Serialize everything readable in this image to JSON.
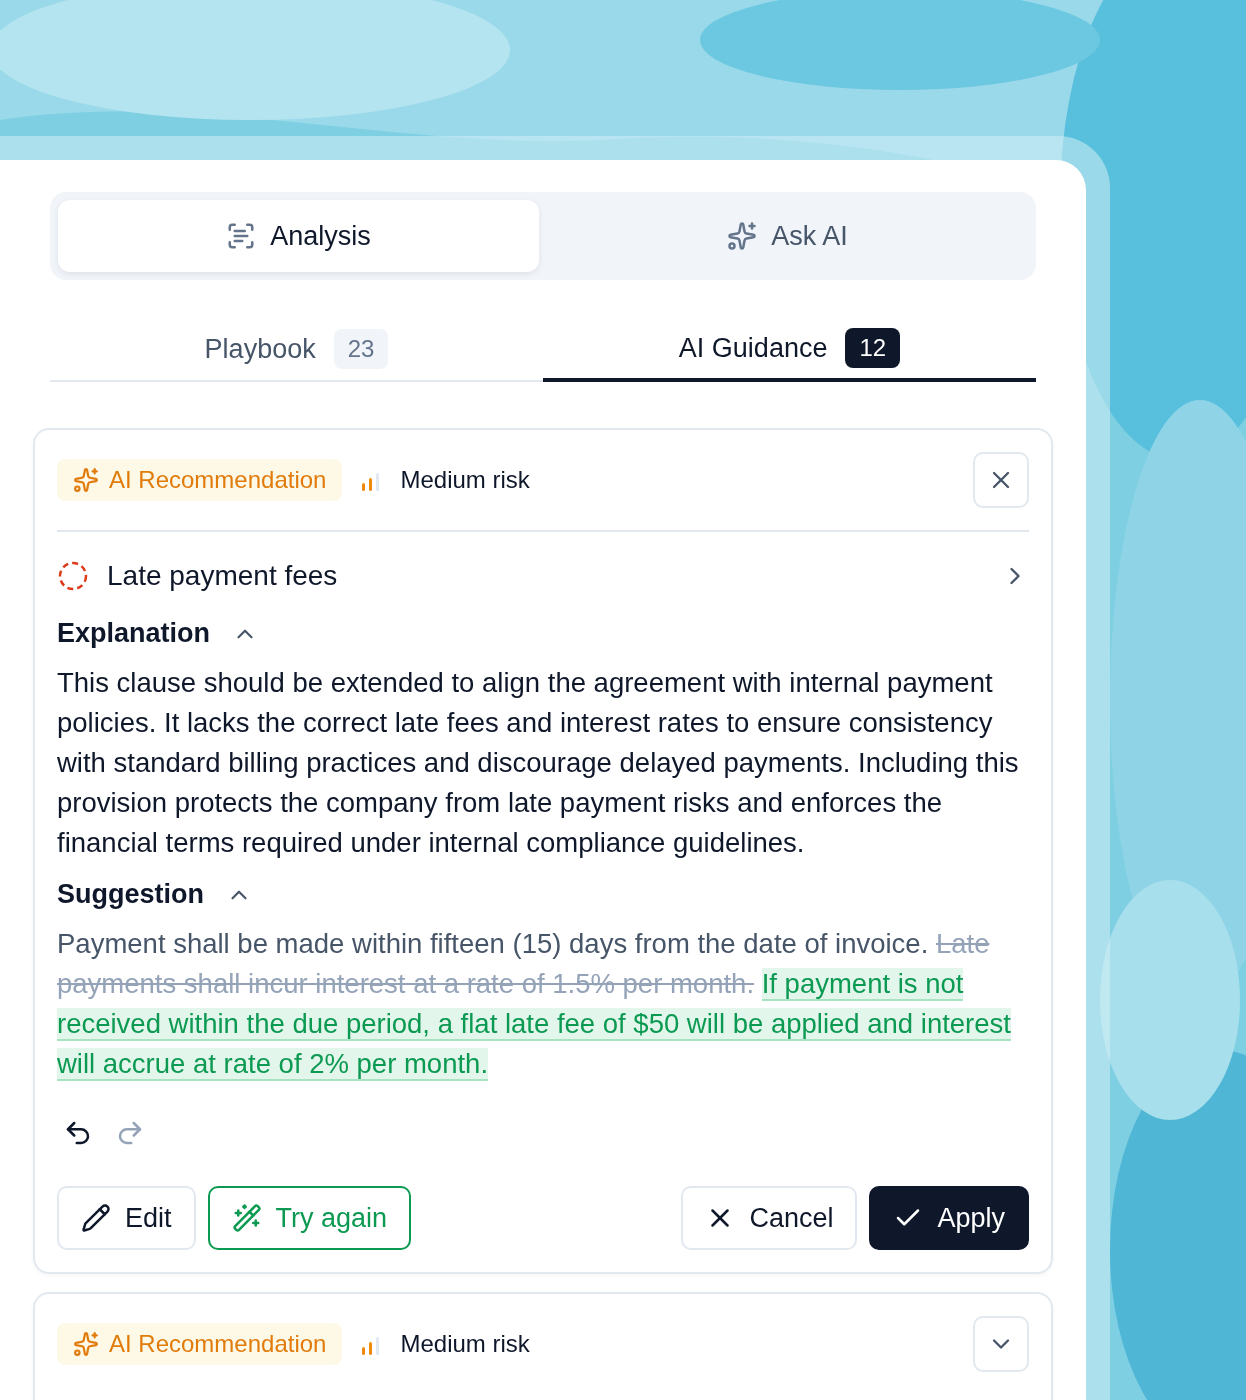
{
  "mode_tabs": [
    {
      "label": "Analysis",
      "selected": true
    },
    {
      "label": "Ask AI",
      "selected": false
    }
  ],
  "list_tabs": [
    {
      "label": "Playbook",
      "count": "23",
      "selected": false
    },
    {
      "label": "AI Guidance",
      "count": "12",
      "selected": true
    }
  ],
  "cards": [
    {
      "badge": "AI Recommendation",
      "risk": {
        "label": "Medium risk",
        "level": 0.67
      },
      "collapsed": false,
      "title": "Late payment fees",
      "sections": [
        {
          "heading": "Explanation",
          "expanded": true,
          "kind": "text",
          "text": "This clause should be extended to align the agreement with internal payment policies. It lacks the correct late fees and interest rates to ensure consistency with standard billing practices and discourage delayed payments. Including this provision protects the company from late payment risks and enforces the financial terms required under internal compliance guidelines."
        },
        {
          "heading": "Suggestion",
          "expanded": true,
          "kind": "diff",
          "segments": [
            {
              "kind": "kept",
              "text": "Payment shall be made within fifteen (15) days from the date of invoice. "
            },
            {
              "kind": "removed",
              "text": "Late payments shall incur interest at a rate of 1.5% per month."
            },
            {
              "kind": "added",
              "text": "If payment is not received within the due period, a flat late fee of $50 will be applied and interest will accrue at rate of 2% per month."
            }
          ]
        }
      ],
      "history": {
        "undo_disabled": false,
        "redo_disabled": true
      },
      "actions": [
        {
          "label": "Edit",
          "kind": "edit"
        },
        {
          "label": "Try again",
          "kind": "retry"
        },
        {
          "label": "Cancel",
          "kind": "cancel"
        },
        {
          "label": "Apply",
          "kind": "apply"
        }
      ]
    },
    {
      "badge": "AI Recommendation",
      "risk": {
        "label": "Medium risk",
        "level": 0.67
      },
      "collapsed": true
    }
  ]
}
